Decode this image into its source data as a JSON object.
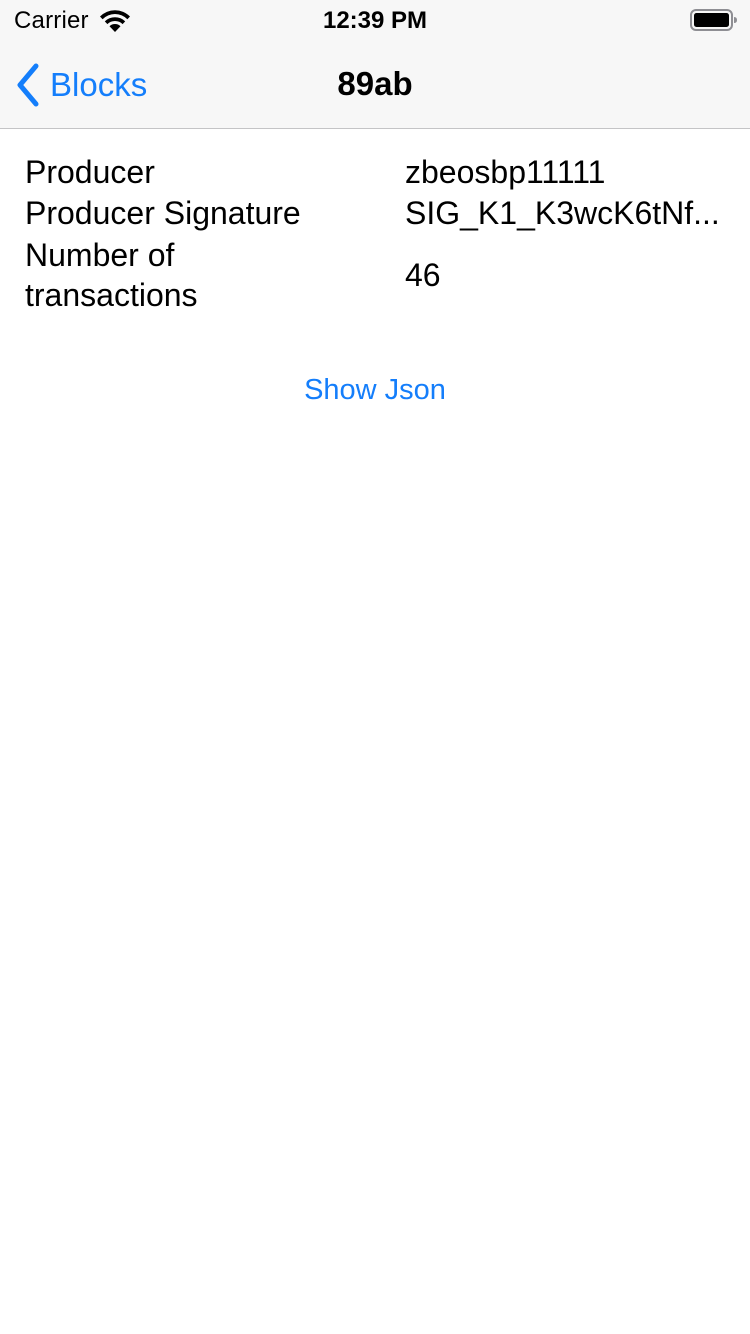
{
  "status_bar": {
    "carrier": "Carrier",
    "time": "12:39 PM",
    "wifi_icon": "wifi-icon",
    "battery_icon": "battery-icon"
  },
  "nav": {
    "back_label": "Blocks",
    "back_icon": "chevron-left-icon",
    "title": "89ab"
  },
  "details": [
    {
      "label": "Producer",
      "value": "zbeosbp11111"
    },
    {
      "label": "Producer Signature",
      "value": "SIG_K1_K3wcK6tNf..."
    },
    {
      "label": "Number of transactions",
      "value": "46"
    }
  ],
  "actions": {
    "show_json": "Show Json"
  },
  "colors": {
    "accent": "#147efb",
    "bar_background": "#f7f7f7",
    "separator": "#c4c4c6"
  }
}
